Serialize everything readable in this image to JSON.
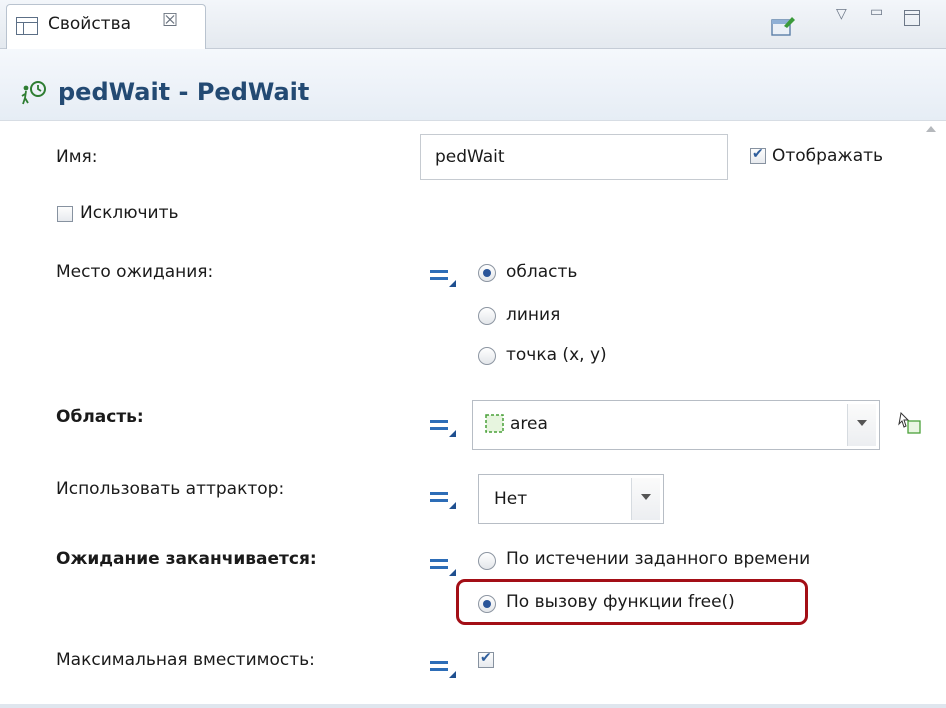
{
  "tab": {
    "title": "Свойства",
    "close_glyph": "☒"
  },
  "window_controls": {
    "menu_glyph": "▽",
    "minimize_glyph": "▭"
  },
  "header": {
    "title": "pedWait - PedWait",
    "icon": "pedestrian-wait-icon"
  },
  "fields": {
    "name": {
      "label": "Имя:",
      "value": "pedWait"
    },
    "show": {
      "label": "Отображать",
      "checked": true
    },
    "exclude": {
      "label": "Исключить",
      "checked": false
    },
    "wait_place": {
      "label": "Место ожидания:",
      "options": [
        "область",
        "линия",
        "точка (x, y)"
      ],
      "selected": "область"
    },
    "area": {
      "label": "Область:",
      "value": "area"
    },
    "attractor": {
      "label": "Использовать аттрактор:",
      "value": "Нет"
    },
    "wait_ends": {
      "label": "Ожидание заканчивается:",
      "options": [
        "По истечении заданного времени",
        "По вызову функции free()"
      ],
      "selected": "По вызову функции free()"
    },
    "max_capacity": {
      "label": "Максимальная вместимость:",
      "checked": true
    }
  },
  "colors": {
    "header_title": "#234a73",
    "highlight": "#a30e16",
    "dynamic_icon": "#2d6db7"
  }
}
